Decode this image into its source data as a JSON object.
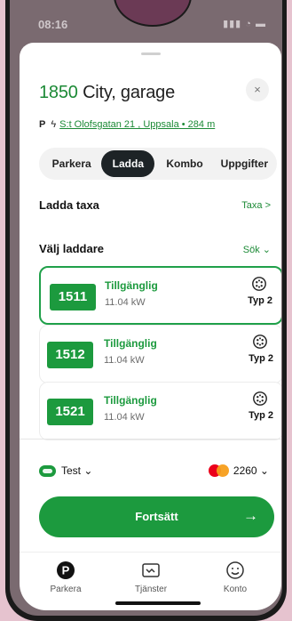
{
  "status_bar": {
    "time": "08:16",
    "icons_text": "▮▮▮ ◔ ▬"
  },
  "header": {
    "number": "1850",
    "name": "City, garage",
    "close_label": "×"
  },
  "address": {
    "p": "P",
    "bolt": "ϟ",
    "text": "S:t Olofsgatan 21 , Uppsala",
    "distance": " • 284 m"
  },
  "tabs": [
    "Parkera",
    "Ladda",
    "Kombo",
    "Uppgifter"
  ],
  "active_tab": "Ladda",
  "ladda_taxa": {
    "label": "Ladda taxa",
    "link": "Taxa >"
  },
  "valj_laddare": {
    "label": "Välj laddare",
    "link": "Sök ⌄"
  },
  "chargers": [
    {
      "id": "1511",
      "status": "Tillgänglig",
      "power": "11.04 kW",
      "type": "Typ 2",
      "selected": true
    },
    {
      "id": "1512",
      "status": "Tillgänglig",
      "power": "11.04 kW",
      "type": "Typ 2",
      "selected": false
    },
    {
      "id": "1521",
      "status": "Tillgänglig",
      "power": "11.04 kW",
      "type": "Typ 2",
      "selected": false
    }
  ],
  "payment": {
    "account": "Test ⌄",
    "card": "2260 ⌄"
  },
  "cta": {
    "label": "Fortsätt",
    "arrow": "→"
  },
  "nav": [
    {
      "label": "Parkera",
      "icon": "parking-icon"
    },
    {
      "label": "Tjänster",
      "icon": "services-icon"
    },
    {
      "label": "Konto",
      "icon": "account-icon"
    }
  ],
  "colors": {
    "brand_green": "#1c9a3e",
    "dark": "#1d2326"
  }
}
